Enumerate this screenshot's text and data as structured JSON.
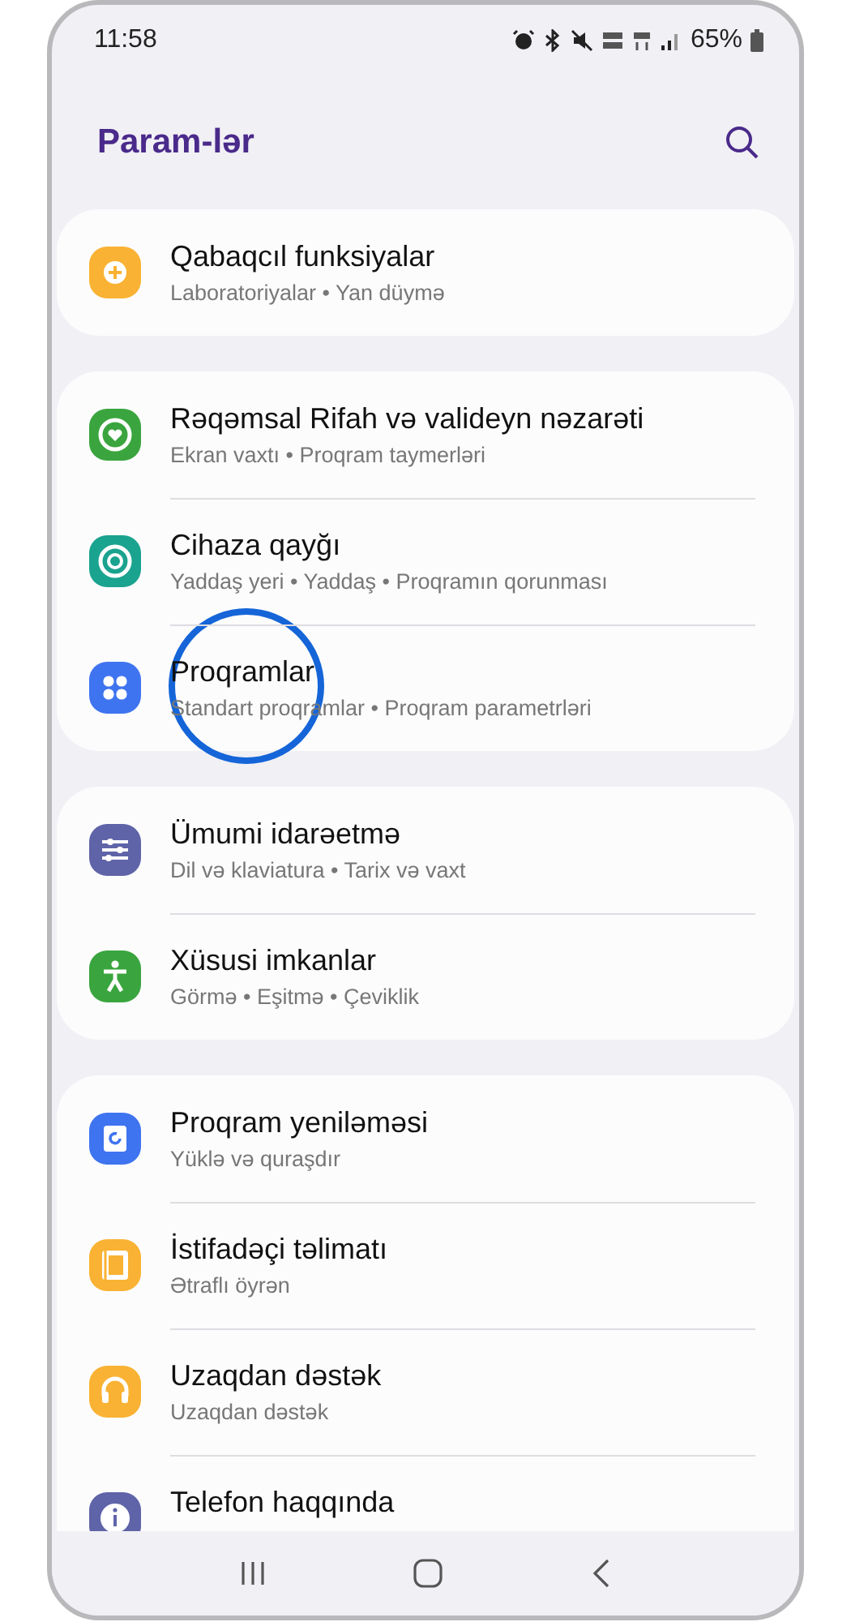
{
  "status_bar": {
    "time": "11:58",
    "battery": "65%"
  },
  "header": {
    "title": "Param-lər"
  },
  "groups": [
    {
      "items": [
        {
          "kind": "advanced",
          "color": "#f9b233",
          "title": "Qabaqcıl funksiyalar",
          "subtitle": "Laboratoriyalar • Yan düymə",
          "highlighted": false
        }
      ]
    },
    {
      "items": [
        {
          "kind": "wellbeing",
          "color": "#3aa53e",
          "title": "Rəqəmsal Rifah və valideyn nəzarəti",
          "subtitle": "Ekran vaxtı • Proqram taymerləri",
          "highlighted": false
        },
        {
          "kind": "care",
          "color": "#1aa38f",
          "title": "Cihaza qayğı",
          "subtitle": "Yaddaş yeri • Yaddaş • Proqramın qorunması",
          "highlighted": false
        },
        {
          "kind": "apps",
          "color": "#3f74f0",
          "title": "Proqramlar",
          "subtitle": "Standart proqramlar • Proqram parametrləri",
          "highlighted": true
        }
      ]
    },
    {
      "items": [
        {
          "kind": "general",
          "color": "#5f64a8",
          "title": "Ümumi idarəetmə",
          "subtitle": "Dil və klaviatura • Tarix və vaxt",
          "highlighted": false
        },
        {
          "kind": "accessibility",
          "color": "#3aa53e",
          "title": "Xüsusi imkanlar",
          "subtitle": "Görmə • Eşitmə • Çeviklik",
          "highlighted": false
        }
      ]
    },
    {
      "items": [
        {
          "kind": "update",
          "color": "#3f74f0",
          "title": "Proqram yeniləməsi",
          "subtitle": "Yüklə və quraşdır",
          "highlighted": false
        },
        {
          "kind": "manual",
          "color": "#f9b233",
          "title": "İstifadəçi təlimatı",
          "subtitle": "Ətraflı öyrən",
          "highlighted": false
        },
        {
          "kind": "support",
          "color": "#f9b233",
          "title": "Uzaqdan dəstək",
          "subtitle": "Uzaqdan dəstək",
          "highlighted": false
        },
        {
          "kind": "about",
          "color": "#5f64a8",
          "title": "Telefon haqqında",
          "highlighted": false
        }
      ]
    }
  ]
}
